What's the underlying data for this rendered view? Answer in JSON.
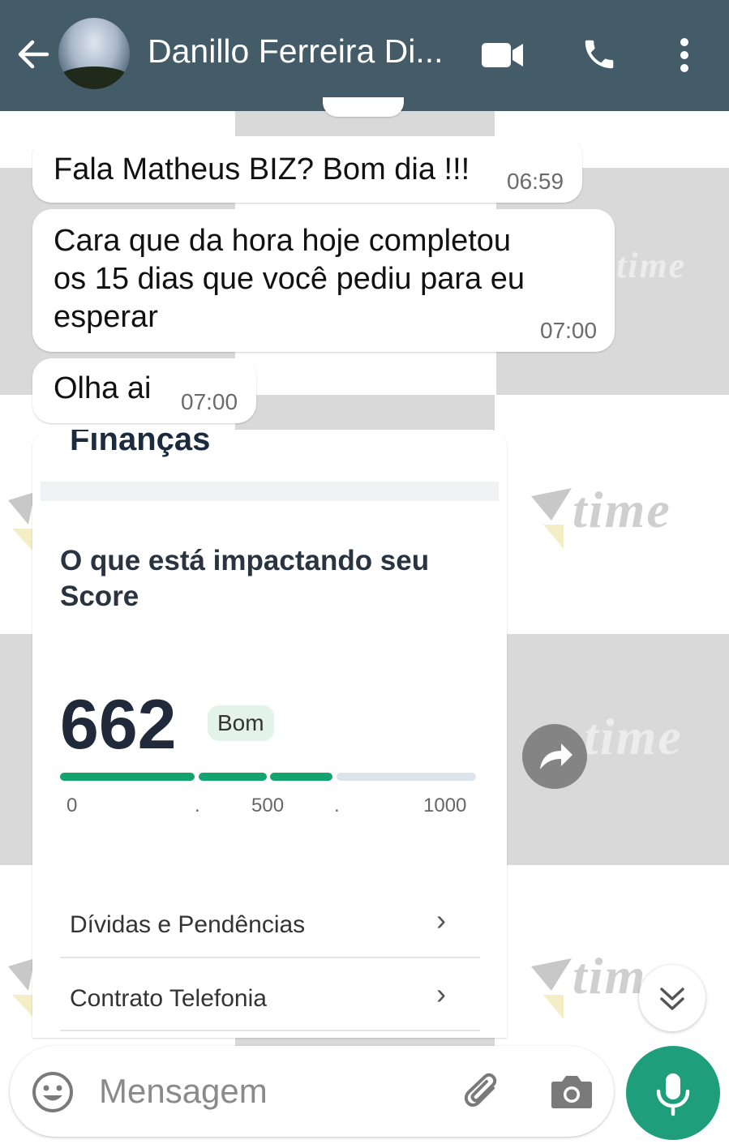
{
  "header": {
    "contact_name": "Danillo Ferreira Di...",
    "icons": [
      "back-arrow-icon",
      "video-call-icon",
      "phone-icon",
      "more-vert-icon"
    ],
    "bg_color": "#445c68"
  },
  "messages": [
    {
      "text": "Fala Matheus BIZ? Bom dia !!!",
      "time": "06:59"
    },
    {
      "text_lines": [
        "Cara que da hora hoje completou",
        "os 15 dias que você pediu para eu",
        "esperar"
      ],
      "time": "07:00"
    },
    {
      "text": "Olha ai",
      "time": "07:00"
    }
  ],
  "image_message": {
    "section_title": "Finanças",
    "impact_title": "O que está impactando seu Score",
    "score": "662",
    "score_label": "Bom",
    "score_fraction": 0.662,
    "scale_ticks": [
      "0",
      ".",
      "500",
      ".",
      "1000"
    ],
    "rows": [
      "Dívidas e Pendências",
      "Contrato Telefonia"
    ],
    "accent_color": "#13a36f"
  },
  "wallpaper": {
    "watermark_text": "time"
  },
  "composer": {
    "placeholder": "Mensagem",
    "icons": [
      "emoji-icon",
      "attach-icon",
      "camera-icon",
      "mic-icon"
    ],
    "mic_color": "#1f9e7c"
  }
}
